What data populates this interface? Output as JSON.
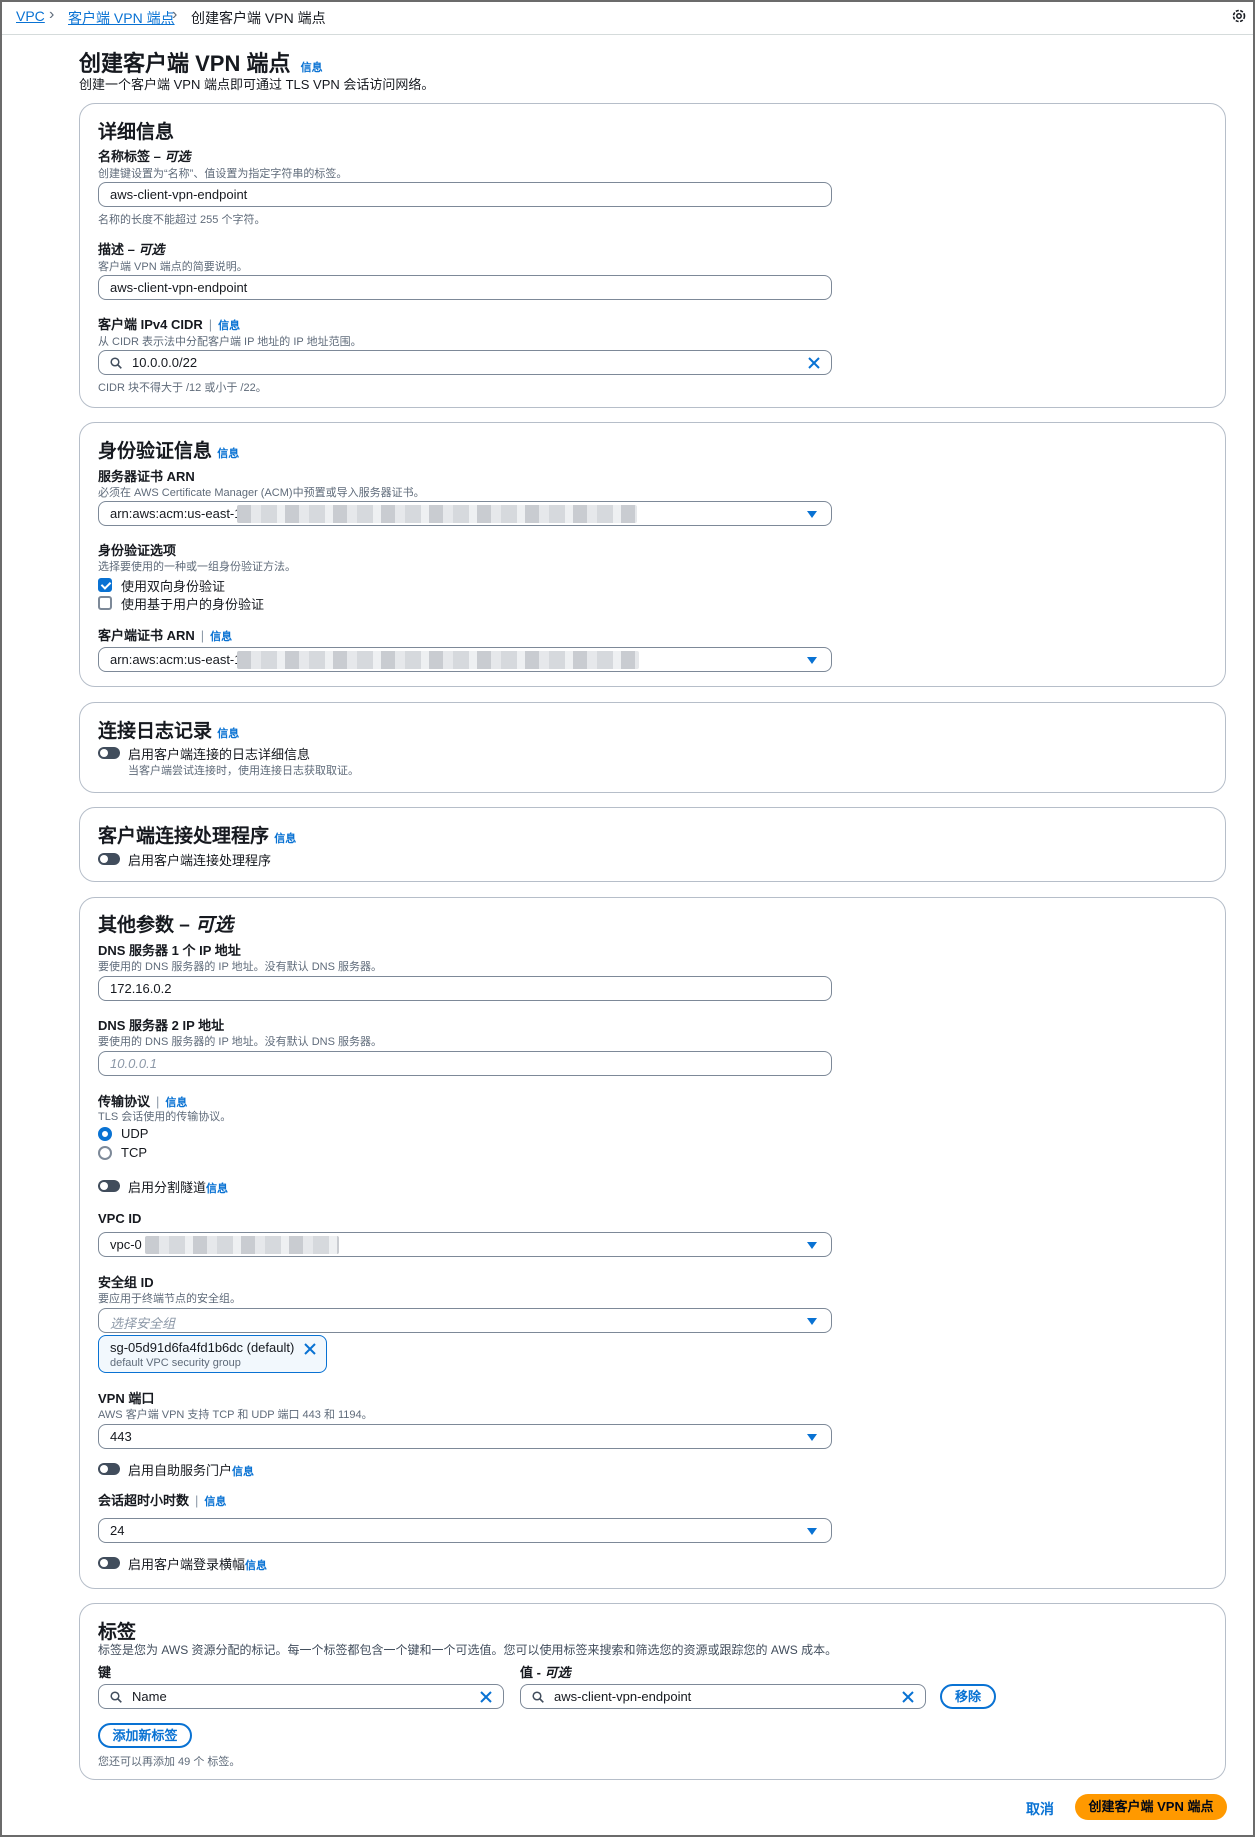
{
  "breadcrumb": [
    "VPC",
    "客户端 VPN 端点",
    "创建客户端 VPN 端点"
  ],
  "page": {
    "title": "创建客户端 VPN 端点",
    "info": "信息",
    "description": "创建一个客户端 VPN 端点即可通过 TLS VPN 会话访问网络。"
  },
  "details": {
    "title": "详细信息",
    "name_tag": {
      "label": "名称标签 – ",
      "optional": "可选",
      "desc": "创建键设置为“名称”、值设置为指定字符串的标签。",
      "value": "aws-client-vpn-endpoint",
      "hint": "名称的长度不能超过 255 个字符。"
    },
    "description": {
      "label": "描述 – ",
      "optional": "可选",
      "desc": "客户端 VPN 端点的简要说明。",
      "value": "aws-client-vpn-endpoint"
    },
    "cidr": {
      "label": "客户端 IPv4 CIDR",
      "info": "信息",
      "desc": "从 CIDR 表示法中分配客户端 IP 地址的 IP 地址范围。",
      "value": "10.0.0.0/22",
      "hint": "CIDR 块不得大于 /12 或小于 /22。"
    }
  },
  "auth": {
    "title": "身份验证信息",
    "info": "信息",
    "server_cert": {
      "label": "服务器证书 ARN",
      "desc": "必须在 AWS Certificate Manager (ACM)中预置或导入服务器证书。",
      "value": "arn:aws:acm:us-east-1"
    },
    "options": {
      "label": "身份验证选项",
      "desc": "选择要使用的一种或一组身份验证方法。",
      "items": [
        {
          "label": "使用双向身份验证",
          "checked": true
        },
        {
          "label": "使用基于用户的身份验证",
          "checked": false
        }
      ]
    },
    "client_cert": {
      "label": "客户端证书 ARN",
      "info": "信息",
      "value": "arn:aws:acm:us-east-1"
    }
  },
  "logging": {
    "title": "连接日志记录",
    "info": "信息",
    "toggle_label": "启用客户端连接的日志详细信息",
    "toggle_desc": "当客户端尝试连接时，使用连接日志获取取证。",
    "enabled": false
  },
  "handler": {
    "title": "客户端连接处理程序",
    "info": "信息",
    "toggle_label": "启用客户端连接处理程序",
    "enabled": false
  },
  "other": {
    "title": "其他参数 – ",
    "optional": "可选",
    "dns1": {
      "label": "DNS 服务器 1 个 IP 地址",
      "desc": "要使用的 DNS 服务器的 IP 地址。没有默认 DNS 服务器。",
      "value": "172.16.0.2"
    },
    "dns2": {
      "label": "DNS 服务器 2 IP 地址",
      "desc": "要使用的 DNS 服务器的 IP 地址。没有默认 DNS 服务器。",
      "placeholder": "10.0.0.1"
    },
    "transport": {
      "label": "传输协议",
      "info": "信息",
      "desc": "TLS 会话使用的传输协议。",
      "options": [
        {
          "label": "UDP",
          "selected": true
        },
        {
          "label": "TCP",
          "selected": false
        }
      ]
    },
    "split_tunnel": {
      "label": "启用分割隧道",
      "info": "信息",
      "enabled": false
    },
    "vpc_id": {
      "label": "VPC ID",
      "value": "vpc-0"
    },
    "security_group": {
      "label": "安全组 ID",
      "desc": "要应用于终端节点的安全组。",
      "placeholder": "选择安全组",
      "token_id": "sg-05d91d6fa4fd1b6dc (default)",
      "token_desc": "default VPC security group"
    },
    "vpn_port": {
      "label": "VPN 端口",
      "desc": "AWS 客户端 VPN 支持 TCP 和 UDP 端口 443 和 1194。",
      "value": "443"
    },
    "self_service": {
      "label": "启用自助服务门户",
      "info": "信息",
      "enabled": false
    },
    "session_timeout": {
      "label": "会话超时小时数",
      "info": "信息",
      "value": "24"
    },
    "banner": {
      "label": "启用客户端登录横幅",
      "info": "信息",
      "enabled": false
    }
  },
  "tags": {
    "title": "标签",
    "desc": "标签是您为 AWS 资源分配的标记。每一个标签都包含一个键和一个可选值。您可以使用标签来搜索和筛选您的资源或跟踪您的 AWS 成本。",
    "key_label": "键",
    "value_label": "值 - ",
    "value_optional": "可选",
    "key_value": "Name",
    "value_value": "aws-client-vpn-endpoint",
    "remove_label": "移除",
    "add_label": "添加新标签",
    "hint": "您还可以再添加 49 个 标签。"
  },
  "footer": {
    "cancel_label": "取消",
    "submit_label": "创建客户端 VPN 端点"
  },
  "colors": {
    "link": "#0972d3",
    "primary_button": "#ff9900",
    "border": "#b6bec9",
    "text": "#16191f",
    "muted": "#5f6b7a"
  }
}
